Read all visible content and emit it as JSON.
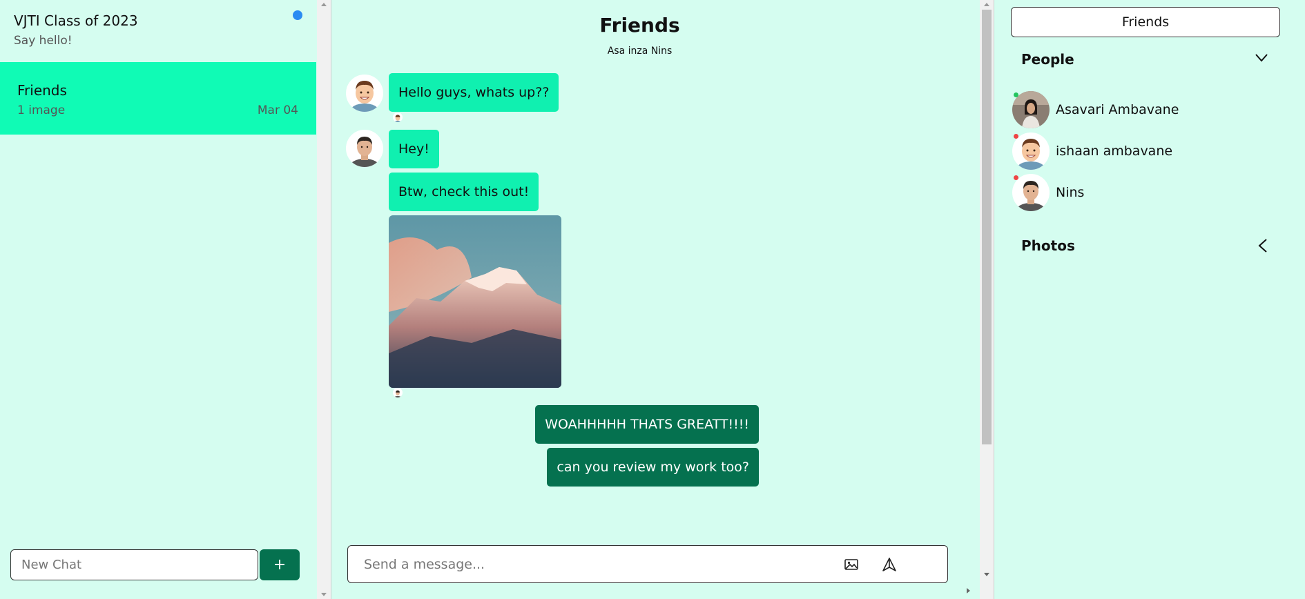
{
  "sidebar": {
    "chats": [
      {
        "title": "VJTI Class of 2023",
        "subtitle": "Say hello!",
        "unread": true
      },
      {
        "title": "Friends",
        "subtitle": "1 image",
        "date": "Mar 04",
        "selected": true
      }
    ],
    "new_chat_placeholder": "New Chat",
    "new_chat_button_icon": "plus-icon"
  },
  "chat": {
    "title": "Friends",
    "members": "Asa inza Nins",
    "messages": [
      {
        "direction": "in",
        "text": "Hello guys, whats up??"
      },
      {
        "direction": "in",
        "text": "Hey!"
      },
      {
        "direction": "in",
        "text": "Btw, check this out!"
      },
      {
        "direction": "in",
        "type": "image",
        "description_icon": "mountain-photo"
      },
      {
        "direction": "out",
        "text": "WOAHHHHH THATS GREATT!!!!"
      },
      {
        "direction": "out",
        "text": "can you review my work too?"
      }
    ],
    "composer": {
      "placeholder": "Send a message...",
      "image_icon": "image-icon",
      "send_icon": "send-icon"
    }
  },
  "details": {
    "tab_label": "Friends",
    "people_label": "People",
    "photos_label": "Photos",
    "people": [
      {
        "name": "Asavari Ambavane",
        "status_color": "#22c55e"
      },
      {
        "name": "ishaan ambavane",
        "status_color": "#ef4444"
      },
      {
        "name": "Nins",
        "status_color": "#ef4444"
      }
    ]
  },
  "colors": {
    "background": "#d5fdf0",
    "selected_chat": "#10fbb5",
    "incoming_bubble": "#10f0b0",
    "outgoing_bubble": "#05714f",
    "unread_dot": "#2a8bf2"
  }
}
